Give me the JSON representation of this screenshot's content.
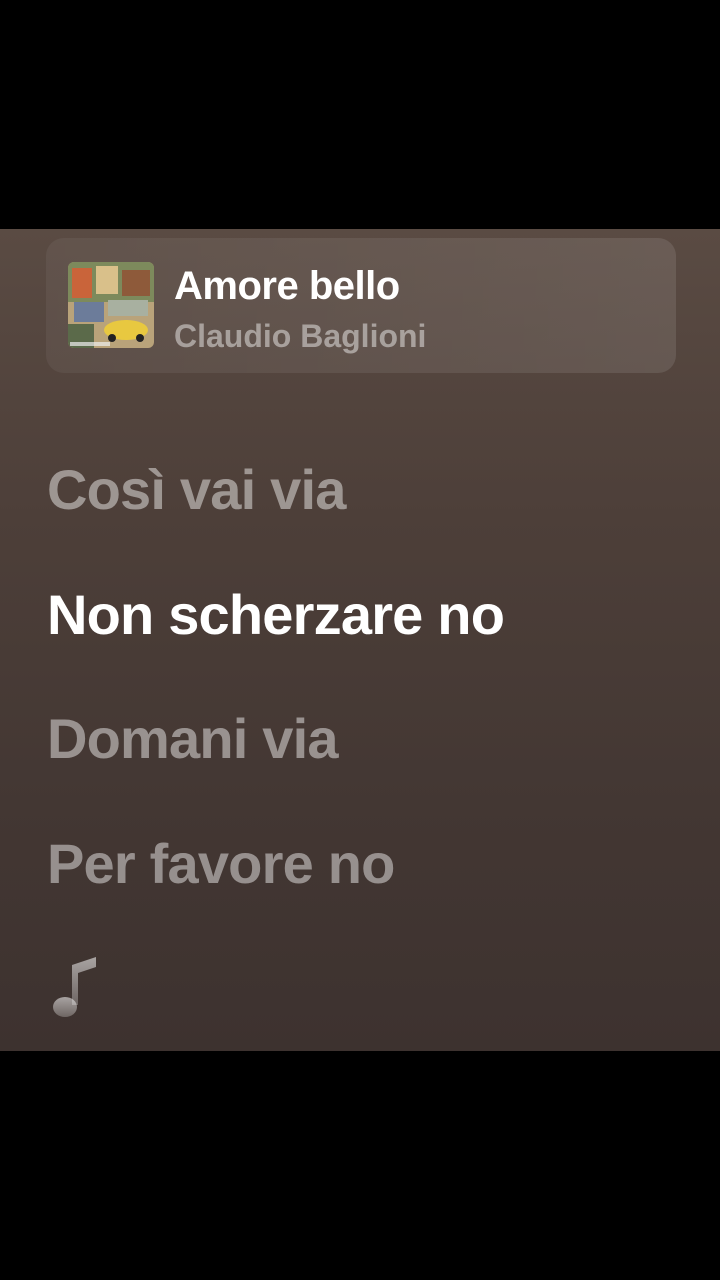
{
  "now_playing": {
    "title": "Amore bello",
    "artist": "Claudio Baglioni",
    "artwork_icon": "album-artwork"
  },
  "lyrics": [
    {
      "text": "Così vai via",
      "state": "past"
    },
    {
      "text": "Non scherzare no",
      "state": "current"
    },
    {
      "text": "Domani via",
      "state": "upcoming"
    },
    {
      "text": "Per favore no",
      "state": "upcoming"
    }
  ],
  "instrumental_icon": "music-note-icon",
  "colors": {
    "background_top": "#5a4b43",
    "background_bottom": "#3d322f",
    "active_lyric": "#ffffff",
    "dim_lyric": "rgba(255,255,255,0.45)"
  }
}
